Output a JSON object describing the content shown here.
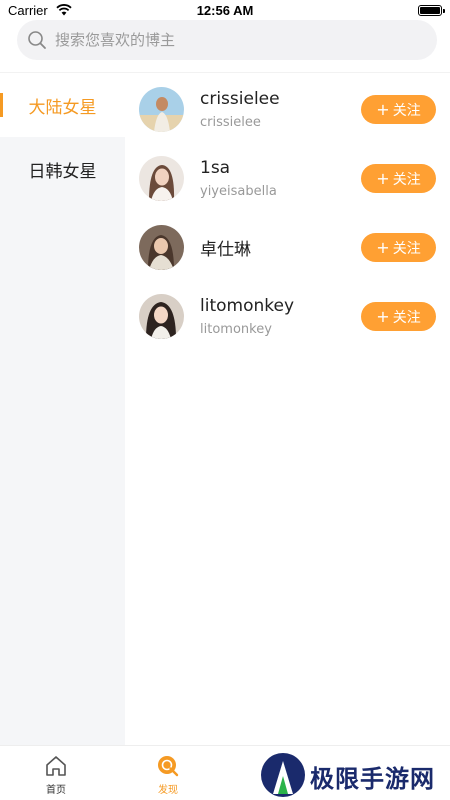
{
  "status_bar": {
    "carrier": "Carrier",
    "time": "12:56 AM"
  },
  "search": {
    "placeholder": "搜索您喜欢的博主",
    "value": ""
  },
  "categories": [
    {
      "label": "大陆女星",
      "active": true
    },
    {
      "label": "日韩女星",
      "active": false
    }
  ],
  "users": [
    {
      "name": "crissielee",
      "handle": "crissielee",
      "follow_label": "关注"
    },
    {
      "name": "1sa",
      "handle": "yiyeisabella",
      "follow_label": "关注"
    },
    {
      "name": "卓仕琳",
      "handle": "",
      "follow_label": "关注"
    },
    {
      "name": "litomonkey",
      "handle": "litomonkey",
      "follow_label": "关注"
    }
  ],
  "tabbar": {
    "tabs": [
      {
        "label": "首页",
        "icon": "home-icon",
        "active": false
      },
      {
        "label": "发现",
        "icon": "discover-icon",
        "active": true
      }
    ]
  },
  "watermark": {
    "text": "极限手游网"
  },
  "colors": {
    "accent": "#f59a23",
    "follow_button": "#ffa033",
    "sidebar_bg": "#f5f6f8",
    "watermark_text": "#1a2a6c"
  }
}
